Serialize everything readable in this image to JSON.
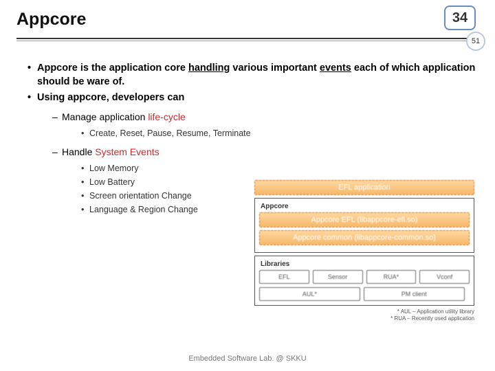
{
  "header": {
    "title": "Appcore",
    "page_number": "34",
    "sub_number": "51"
  },
  "bullets": {
    "b1a": "Appcore is the application core ",
    "b1b": "handling",
    "b1c": " various important ",
    "b1d": "events",
    "b1e": " each of which application should be ware of.",
    "b2": "Using appcore, developers can",
    "d1a": "Manage application ",
    "d1b": "life-cycle",
    "d1_items": {
      "i0": "Create, Reset, Pause, Resume, Terminate"
    },
    "d2a": "Handle ",
    "d2b": "System Events",
    "d2_items": {
      "i0": "Low Memory",
      "i1": "Low Battery",
      "i2": "Screen orientation Change",
      "i3": "Language & Region Change"
    }
  },
  "diagram": {
    "top": "EFL application",
    "appcore_label": "Appcore",
    "efl": "Appcore EFL (libappcore-efl.so)",
    "common": "Appcore common (libappcore-common.so)",
    "lib_label": "Libraries",
    "libs": {
      "l0": "EFL",
      "l1": "Sensor",
      "l2": "RUA*",
      "l3": "Vconf",
      "l4": "AUL*",
      "l5": "PM client"
    },
    "foot1": "* AUL – Application utility library",
    "foot2": "* RUA – Recently used application"
  },
  "footer": "Embedded Software Lab. @ SKKU"
}
